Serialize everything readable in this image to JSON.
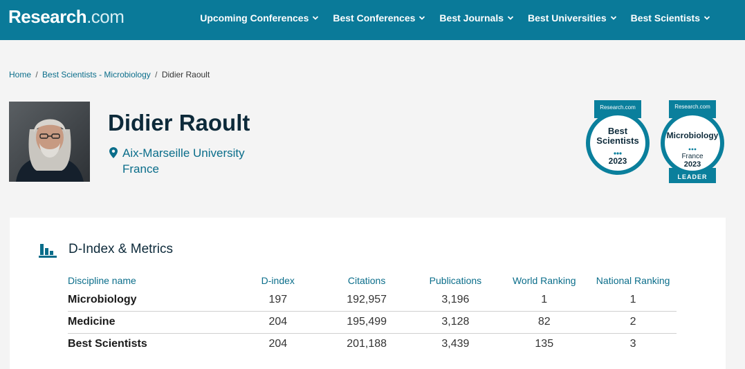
{
  "brand": {
    "name": "Research",
    "tld": ".com"
  },
  "nav": [
    {
      "label": "Upcoming Conferences"
    },
    {
      "label": "Best Conferences"
    },
    {
      "label": "Best Journals"
    },
    {
      "label": "Best Universities"
    },
    {
      "label": "Best Scientists"
    }
  ],
  "breadcrumb": {
    "home": "Home",
    "category": "Best Scientists - Microbiology",
    "current": "Didier Raoult",
    "sep": "/"
  },
  "profile": {
    "name": "Didier Raoult",
    "institution": "Aix-Marseille University",
    "country": "France"
  },
  "badges": {
    "best": {
      "brand": "Research.com",
      "line1": "Best",
      "line2": "Scientists",
      "year": "2023"
    },
    "leader": {
      "brand": "Research.com",
      "field": "Microbiology",
      "country": "France",
      "year": "2023",
      "ribbon": "LEADER"
    }
  },
  "metrics": {
    "title": "D-Index & Metrics",
    "columns": [
      "Discipline name",
      "D-index",
      "Citations",
      "Publications",
      "World Ranking",
      "National Ranking"
    ],
    "rows": [
      [
        "Microbiology",
        "197",
        "192,957",
        "3,196",
        "1",
        "1"
      ],
      [
        "Medicine",
        "204",
        "195,499",
        "3,128",
        "82",
        "2"
      ],
      [
        "Best Scientists",
        "204",
        "201,188",
        "3,439",
        "135",
        "3"
      ]
    ]
  },
  "colors": {
    "brand_bar": "#0a7a99",
    "link": "#0a6d8a",
    "heading": "#0d2a3a",
    "badge_teal": "#0a7f9c"
  },
  "icons": [
    "chevron-down-icon",
    "location-pin-icon",
    "bar-chart-icon"
  ]
}
